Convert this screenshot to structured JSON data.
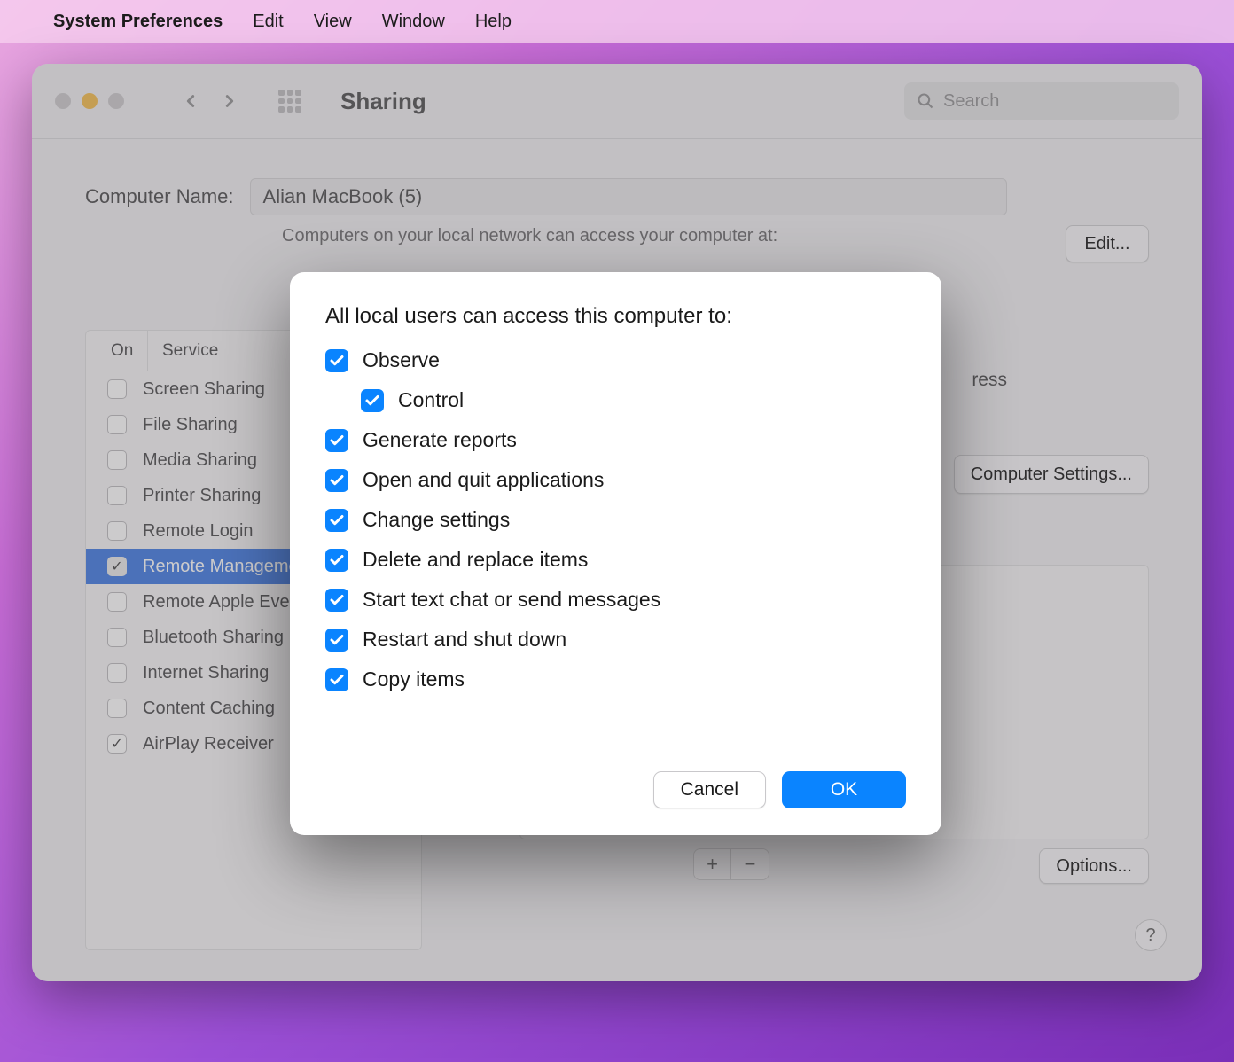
{
  "menubar": {
    "appname": "System Preferences",
    "items": [
      "Edit",
      "View",
      "Window",
      "Help"
    ]
  },
  "window": {
    "title": "Sharing",
    "search_placeholder": "Search"
  },
  "sharing": {
    "computer_name_label": "Computer Name:",
    "computer_name_value": "Alian MacBook (5)",
    "subtext": "Computers on your local network can access your computer at:",
    "edit_label": "Edit...",
    "on_header": "On",
    "service_header": "Service",
    "services": [
      {
        "checked": false,
        "label": "Screen Sharing"
      },
      {
        "checked": false,
        "label": "File Sharing"
      },
      {
        "checked": false,
        "label": "Media Sharing"
      },
      {
        "checked": false,
        "label": "Printer Sharing"
      },
      {
        "checked": false,
        "label": "Remote Login"
      },
      {
        "checked": true,
        "label": "Remote Management",
        "selected": true
      },
      {
        "checked": false,
        "label": "Remote Apple Events"
      },
      {
        "checked": false,
        "label": "Bluetooth Sharing"
      },
      {
        "checked": false,
        "label": "Internet Sharing"
      },
      {
        "checked": false,
        "label": "Content Caching"
      },
      {
        "checked": true,
        "label": "AirPlay Receiver"
      }
    ],
    "address_stub": "ress",
    "computer_settings_label": "Computer Settings...",
    "options_label": "Options...",
    "help_label": "?"
  },
  "modal": {
    "title": "All local users can access this computer to:",
    "options": [
      {
        "checked": true,
        "label": "Observe",
        "indent": false
      },
      {
        "checked": true,
        "label": "Control",
        "indent": true
      },
      {
        "checked": true,
        "label": "Generate reports",
        "indent": false
      },
      {
        "checked": true,
        "label": "Open and quit applications",
        "indent": false
      },
      {
        "checked": true,
        "label": "Change settings",
        "indent": false
      },
      {
        "checked": true,
        "label": "Delete and replace items",
        "indent": false
      },
      {
        "checked": true,
        "label": "Start text chat or send messages",
        "indent": false
      },
      {
        "checked": true,
        "label": "Restart and shut down",
        "indent": false
      },
      {
        "checked": true,
        "label": "Copy items",
        "indent": false
      }
    ],
    "cancel_label": "Cancel",
    "ok_label": "OK"
  }
}
